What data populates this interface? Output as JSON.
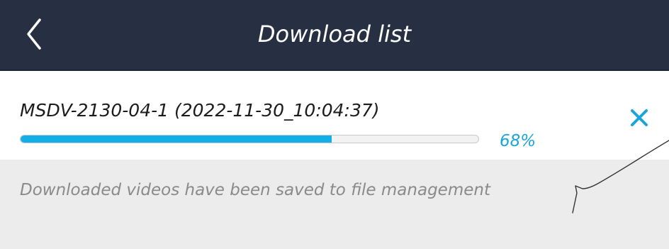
{
  "header": {
    "title": "Download list",
    "back_icon": "chevron-left-icon"
  },
  "download_item": {
    "file_name": "MSDV-2130-04-1 (2022-11-30_10:04:37)",
    "progress_percent": 68,
    "progress_label": "68%",
    "close_icon": "close-icon"
  },
  "notice": {
    "text": "Downloaded videos have been saved to file management"
  },
  "colors": {
    "header_bg": "#272f43",
    "accent": "#12aee8",
    "notice_bg": "#ececec",
    "notice_text": "#8a8a8a"
  }
}
